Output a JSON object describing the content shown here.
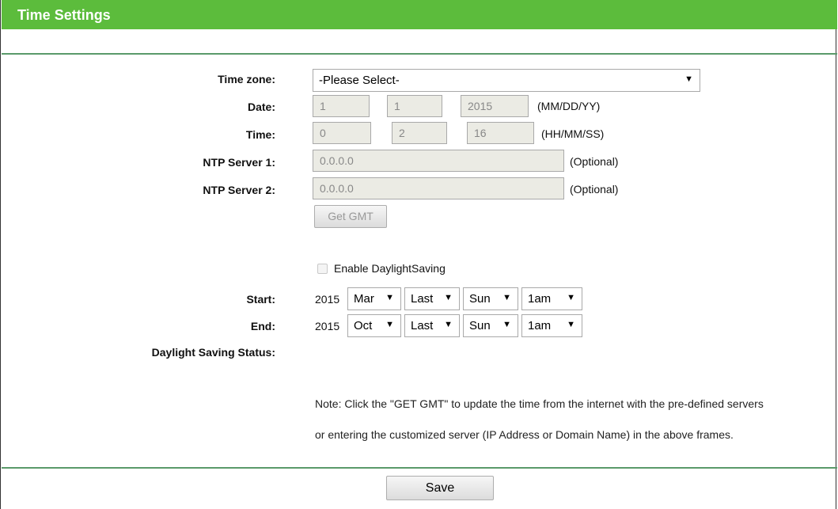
{
  "page": {
    "title": "Time Settings"
  },
  "form": {
    "timezone": {
      "label": "Time zone:",
      "value": "-Please Select-"
    },
    "date": {
      "label": "Date:",
      "mm": "1",
      "dd": "1",
      "yy": "2015",
      "format": "(MM/DD/YY)"
    },
    "time": {
      "label": "Time:",
      "hh": "0",
      "mm": "2",
      "ss": "16",
      "format": "(HH/MM/SS)"
    },
    "ntp1": {
      "label": "NTP Server 1:",
      "value": "0.0.0.0",
      "hint": "(Optional)"
    },
    "ntp2": {
      "label": "NTP Server 2:",
      "value": "0.0.0.0",
      "hint": "(Optional)"
    },
    "get_gmt_label": "Get GMT",
    "daylight": {
      "enable_label": "Enable DaylightSaving",
      "start": {
        "label": "Start:",
        "year": "2015",
        "month": "Mar",
        "week": "Last",
        "day": "Sun",
        "hour": "1am"
      },
      "end": {
        "label": "End:",
        "year": "2015",
        "month": "Oct",
        "week": "Last",
        "day": "Sun",
        "hour": "1am"
      },
      "status_label": "Daylight Saving Status:"
    },
    "note_line1": "Note: Click the \"GET GMT\" to update the time from the internet with the pre-defined servers",
    "note_line2": "or entering the customized server (IP Address or Domain Name) in the above frames."
  },
  "footer": {
    "save_label": "Save"
  }
}
